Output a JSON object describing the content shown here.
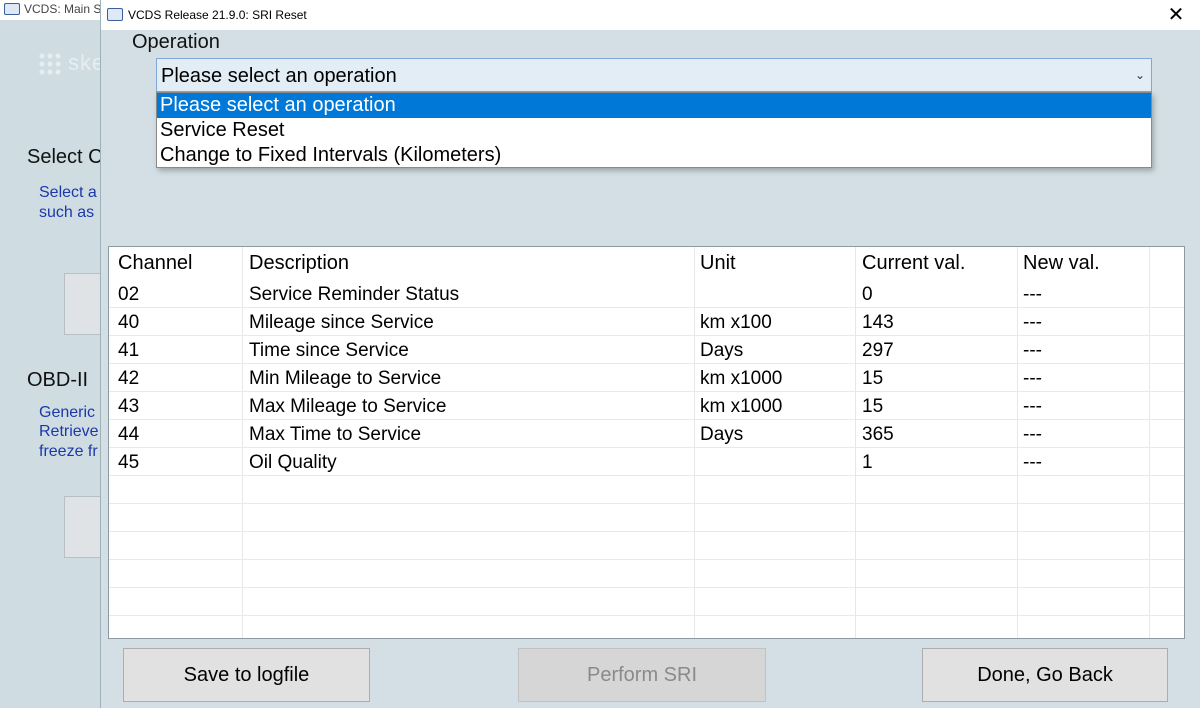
{
  "main_window": {
    "title": "VCDS:  Main S",
    "watermark": "skelbiu.lt",
    "heading1": "Select C",
    "desc1_line1": "Select a",
    "desc1_line2": "such as",
    "heading2": "OBD-II",
    "desc2_line1": "Generic",
    "desc2_line2": "Retrieve",
    "desc2_line3": "freeze fr"
  },
  "dialog": {
    "title": "VCDS Release 21.9.0:  SRI Reset",
    "close_glyph": "✕",
    "app_icon_text": "VCDS"
  },
  "operation": {
    "label": "Operation",
    "selected": "Please select an operation",
    "arrow_glyph": "⌄",
    "options": [
      "Please select an operation",
      "Service Reset",
      "Change to Fixed Intervals (Kilometers)"
    ]
  },
  "table": {
    "headers": {
      "channel": "Channel",
      "description": "Description",
      "unit": "Unit",
      "current": "Current val.",
      "new": "New val."
    },
    "rows": [
      {
        "channel": "02",
        "description": "Service Reminder Status",
        "unit": "",
        "current": "0",
        "new": "---"
      },
      {
        "channel": "40",
        "description": "Mileage since Service",
        "unit": "km x100",
        "current": "143",
        "new": "---"
      },
      {
        "channel": "41",
        "description": "Time since Service",
        "unit": "Days",
        "current": "297",
        "new": "---"
      },
      {
        "channel": "42",
        "description": "Min Mileage to Service",
        "unit": "km x1000",
        "current": "15",
        "new": "---"
      },
      {
        "channel": "43",
        "description": "Max Mileage to Service",
        "unit": "km x1000",
        "current": "15",
        "new": "---"
      },
      {
        "channel": "44",
        "description": "Max Time to Service",
        "unit": "Days",
        "current": "365",
        "new": "---"
      },
      {
        "channel": "45",
        "description": "Oil Quality",
        "unit": "",
        "current": "1",
        "new": "---"
      }
    ]
  },
  "buttons": {
    "save": "Save to logfile",
    "perform": "Perform SRI",
    "done": "Done, Go Back"
  },
  "colors": {
    "selection": "#0078d7",
    "dialog_bg": "#d3dfe4",
    "link_text": "#1c38a8"
  }
}
